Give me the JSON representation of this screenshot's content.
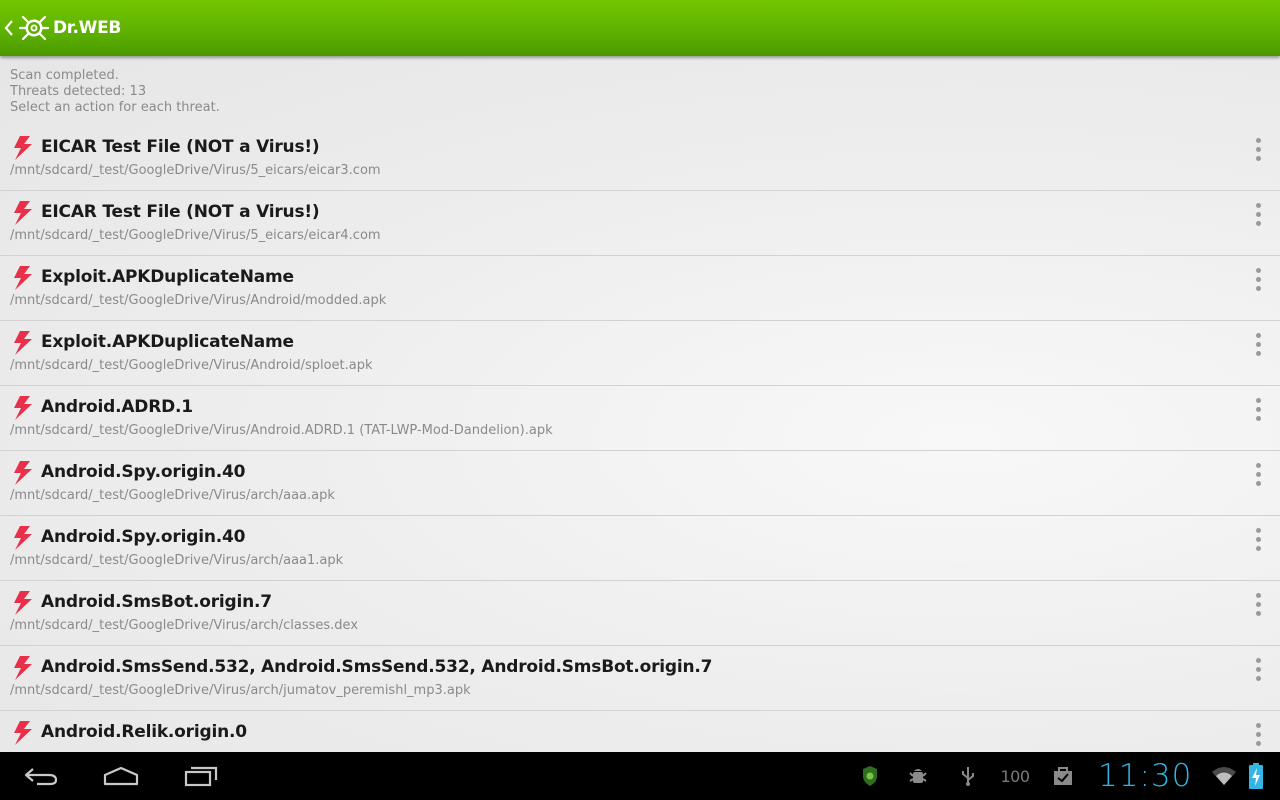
{
  "app": {
    "title": "Dr.WEB"
  },
  "summary": {
    "line1": "Scan completed.",
    "line2": "Threats detected: 13",
    "line3": "Select an action for each threat."
  },
  "threats": [
    {
      "name": "EICAR Test File (NOT a Virus!)",
      "path": "/mnt/sdcard/_test/GoogleDrive/Virus/5_eicars/eicar3.com"
    },
    {
      "name": "EICAR Test File (NOT a Virus!)",
      "path": "/mnt/sdcard/_test/GoogleDrive/Virus/5_eicars/eicar4.com"
    },
    {
      "name": "Exploit.APKDuplicateName",
      "path": "/mnt/sdcard/_test/GoogleDrive/Virus/Android/modded.apk"
    },
    {
      "name": "Exploit.APKDuplicateName",
      "path": "/mnt/sdcard/_test/GoogleDrive/Virus/Android/sploet.apk"
    },
    {
      "name": "Android.ADRD.1",
      "path": "/mnt/sdcard/_test/GoogleDrive/Virus/Android.ADRD.1 (TAT-LWP-Mod-Dandelion).apk"
    },
    {
      "name": "Android.Spy.origin.40",
      "path": "/mnt/sdcard/_test/GoogleDrive/Virus/arch/aaa.apk"
    },
    {
      "name": "Android.Spy.origin.40",
      "path": "/mnt/sdcard/_test/GoogleDrive/Virus/arch/aaa1.apk"
    },
    {
      "name": "Android.SmsBot.origin.7",
      "path": "/mnt/sdcard/_test/GoogleDrive/Virus/arch/classes.dex"
    },
    {
      "name": "Android.SmsSend.532, Android.SmsSend.532, Android.SmsBot.origin.7",
      "path": "/mnt/sdcard/_test/GoogleDrive/Virus/arch/jumatov_peremishl_mp3.apk"
    },
    {
      "name": "Android.Relik.origin.0",
      "path": ""
    }
  ],
  "statusbar": {
    "battery_level": "100",
    "time": "11:30"
  },
  "icons": {
    "up": "chevron-left-icon",
    "logo": "drweb-spider-icon",
    "threat": "lightning-bolt-icon",
    "overflow": "overflow-menu-icon",
    "back": "back-icon",
    "home": "home-icon",
    "recents": "recent-apps-icon",
    "drweb_status": "drweb-shield-icon",
    "usb_debug": "android-debug-icon",
    "usb": "usb-icon",
    "store": "shopping-bag-icon",
    "wifi": "wifi-icon",
    "battery": "battery-charging-icon"
  },
  "colors": {
    "actionbar": "#5db000",
    "threat_icon": "#e8304a",
    "clock": "#33b5e5"
  }
}
